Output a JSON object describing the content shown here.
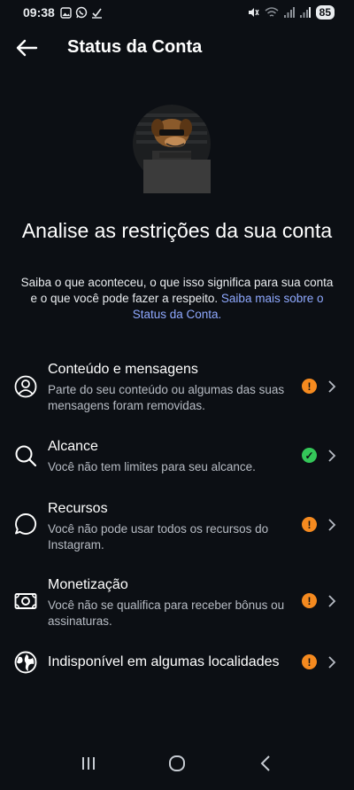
{
  "statusbar": {
    "time": "09:38",
    "battery": "85",
    "left_icons": [
      "image-icon",
      "whatsapp-icon",
      "download-check-icon"
    ],
    "right_icons": [
      "mute-icon",
      "wifi-icon",
      "signal-icon",
      "signal-icon"
    ]
  },
  "header": {
    "title": "Status da Conta"
  },
  "main": {
    "headline": "Analise as restrições da sua conta",
    "subtext": "Saiba o que aconteceu, o que isso significa para sua conta e o que você pode fazer a respeito. ",
    "subtext_link": "Saiba mais sobre o Status da Conta."
  },
  "items": [
    {
      "title": "Conteúdo e mensagens",
      "description": "Parte do seu conteúdo ou algumas das suas mensagens foram removidas.",
      "icon": "user-circle-icon",
      "status": "warning",
      "status_symbol": "!"
    },
    {
      "title": "Alcance",
      "description": "Você não tem limites para seu alcance.",
      "icon": "search-icon",
      "status": "ok",
      "status_symbol": "✓"
    },
    {
      "title": "Recursos",
      "description": "Você não pode usar todos os recursos do Instagram.",
      "icon": "chat-bubble-icon",
      "status": "warning",
      "status_symbol": "!"
    },
    {
      "title": "Monetização",
      "description": "Você não se qualifica para receber bônus ou assinaturas.",
      "icon": "money-icon",
      "status": "warning",
      "status_symbol": "!"
    },
    {
      "title": "Indisponível em algumas localidades",
      "description": "",
      "icon": "globe-icon",
      "status": "warning",
      "status_symbol": "!"
    }
  ],
  "colors": {
    "background": "#0c0f14",
    "warning": "#f58a1f",
    "ok": "#34c759",
    "link": "#8fa9ff"
  }
}
